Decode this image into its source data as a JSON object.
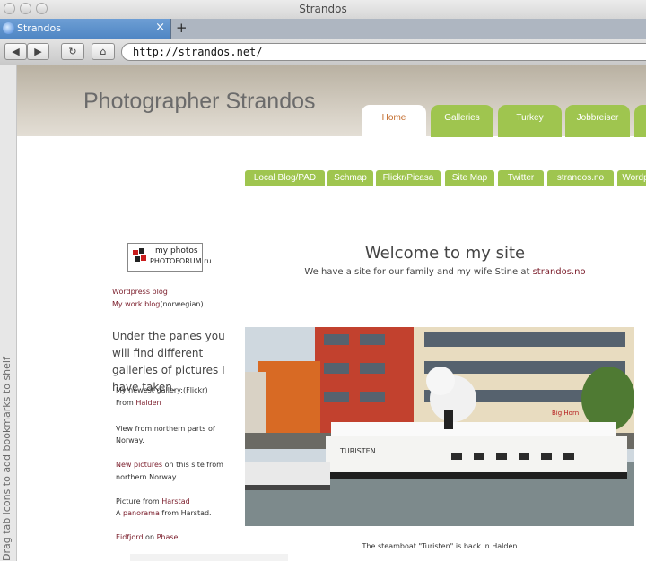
{
  "window": {
    "title": "Strandos"
  },
  "tabbar": {
    "tab_label": "Strandos",
    "close_glyph": "×",
    "new_tab_glyph": "+"
  },
  "toolbar": {
    "back_glyph": "◀",
    "forward_glyph": "▶",
    "reload_glyph": "↻",
    "home_glyph": "⌂",
    "url": "http://strandos.net/"
  },
  "shelf": {
    "text": "Drag tab icons to add bookmarks to shelf"
  },
  "site": {
    "title": "Photographer Strandos",
    "nav_tabs": [
      "Home",
      "Galleries",
      "Turkey",
      "Jobbreiser",
      ""
    ],
    "sub_nav": [
      "Local Blog/PAD",
      "Schmap",
      "Flickr/Picasa",
      "Site Map",
      "Twitter",
      "strandos.no",
      "Wordp"
    ]
  },
  "sidebar": {
    "badge_line1": "my photos",
    "badge_line2": "PHOTOFORUM.ru",
    "wp_label": "Wordpress blog",
    "work_blog_link": "My work blog",
    "work_blog_suffix": "(norwegian)",
    "intro": "Under the panes you will find different galleries of pictures I have taken.",
    "newest": "My newest gallery:(Flickr)",
    "from": "From ",
    "halden_link": "Halden",
    "view_link": "View from northern parts of Norway.",
    "new_pictures_link": "New pictures",
    "new_pictures_suffix": " on this site from",
    "northern_norway": "northern Norway",
    "harstad_pre": "Picture from ",
    "harstad_link": "Harstad",
    "panorama_pre": "A ",
    "panorama_link": "panorama",
    "panorama_suffix": " from Harstad.",
    "eidfjord_link": "Eidfjord",
    "eidfjord_mid": " on ",
    "pbase_link": "Pbase",
    "eidfjord_end": "."
  },
  "main": {
    "welcome": "Welcome to my site",
    "sub_text": "We have a site for our family and my wife Stine at ",
    "sub_link": "strandos.no",
    "caption": "The steamboat \"Turisten\" is back in Halden",
    "boat_name": "TURISTEN",
    "sign": "Big Horn"
  },
  "colors": {
    "nav_green": "#9fc54f",
    "link": "#7a1c2a",
    "header": "#c9c2b4"
  }
}
